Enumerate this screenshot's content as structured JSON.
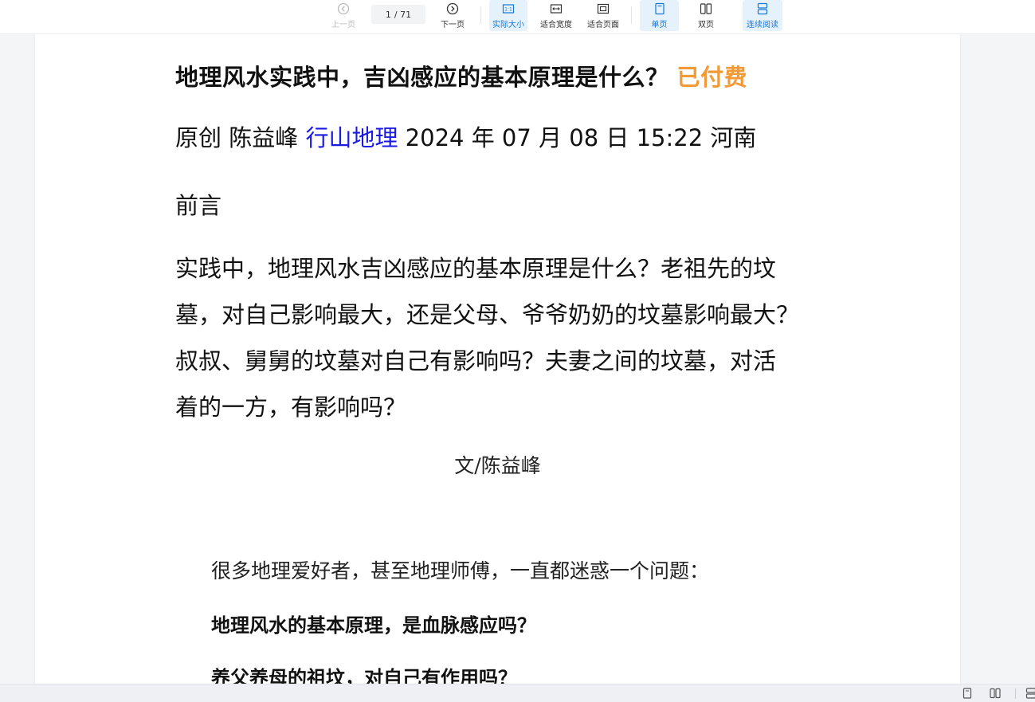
{
  "toolbar": {
    "prev_label": "上一页",
    "next_label": "下一页",
    "current_page": "1",
    "total_pages": "/ 71",
    "actual_size_label": "实际大小",
    "fit_width_label": "适合宽度",
    "fit_page_label": "适合页面",
    "single_page_label": "单页",
    "double_page_label": "双页",
    "continuous_label": "连续阅读",
    "accent_color": "#1677d9"
  },
  "article": {
    "title": "地理风水实践中，吉凶感应的基本原理是什么？",
    "paid_badge": "已付费",
    "meta_prefix": "原创 陈益峰",
    "account": "行山地理",
    "meta_suffix": "2024 年 07 月 08 日  15:22 河南",
    "preface": "前言",
    "intro_lines": [
      "实践中，地理风水吉凶感应的基本原理是什么？老祖先的坟",
      "墓，对自己影响最大，还是父母、爷爷奶奶的坟墓影响最大？",
      "叔叔、舅舅的坟墓对自己有影响吗？夫妻之间的坟墓，对活",
      "着的一方，有影响吗？"
    ],
    "byline": "文/陈益峰",
    "body_line_1": "很多地理爱好者，甚至地理师傅，一直都迷惑一个问题：",
    "question_1": "地理风水的基本原理，是血脉感应吗？",
    "question_2": "养父养母的祖坟，对自己有作用吗？"
  }
}
